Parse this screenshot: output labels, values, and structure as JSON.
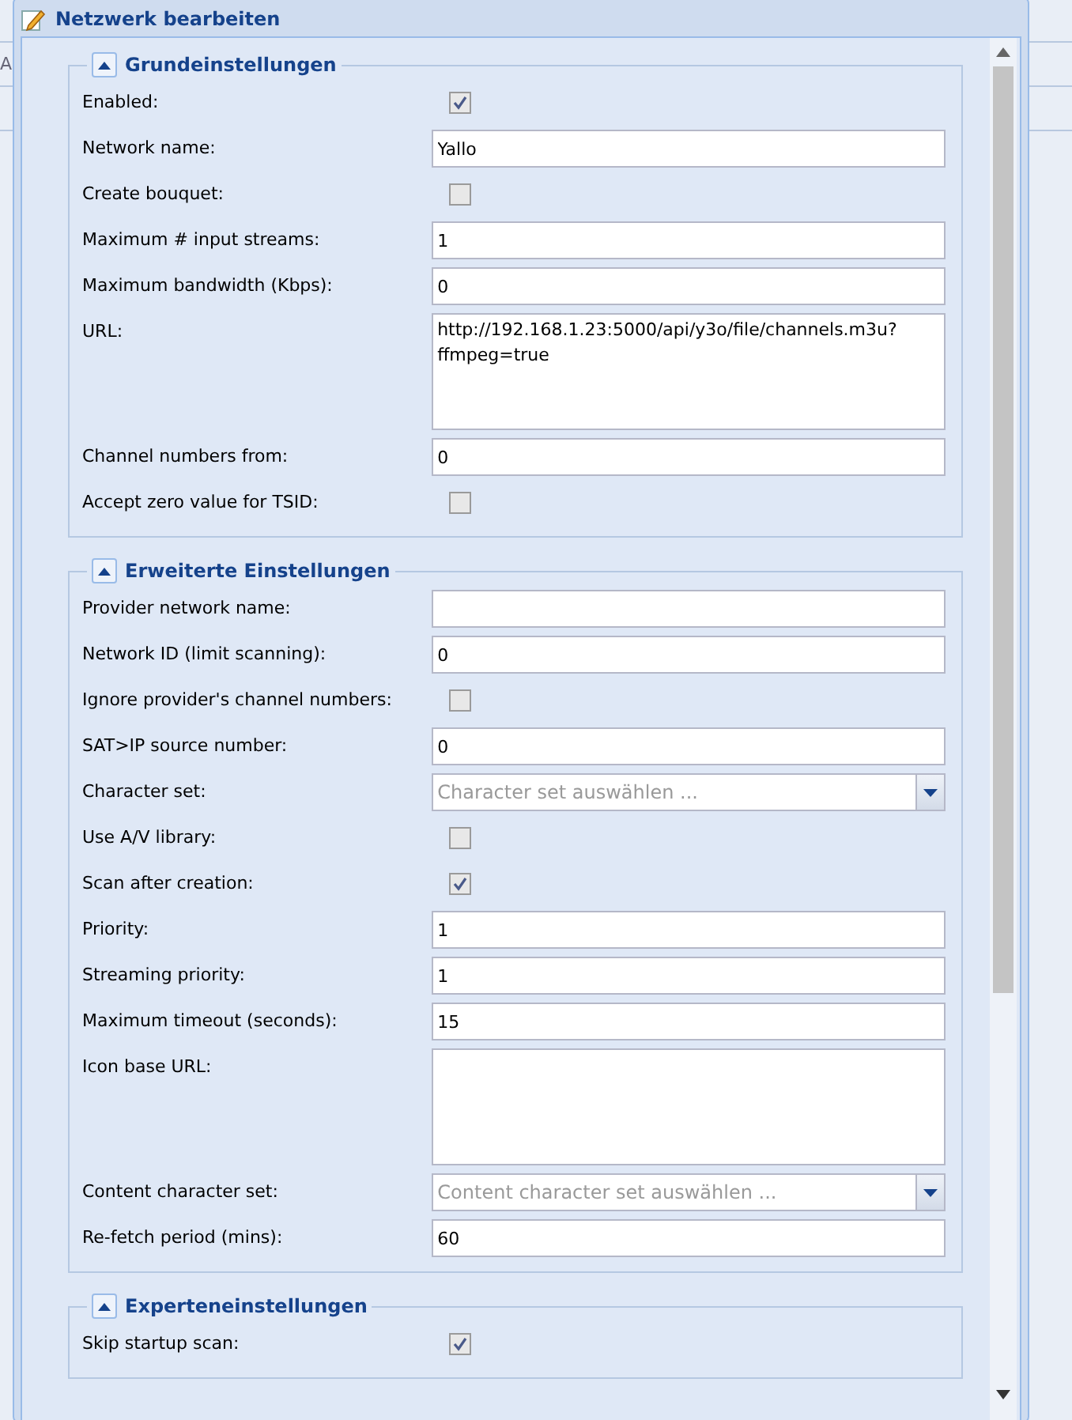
{
  "background": {
    "fragment": "A"
  },
  "window": {
    "title": "Netzwerk bearbeiten"
  },
  "fieldsets": [
    {
      "legend": "Grundeinstellungen",
      "expanded": true,
      "fields": [
        {
          "kind": "checkbox",
          "label": "Enabled:",
          "checked": true
        },
        {
          "kind": "text",
          "label": "Network name:",
          "value": "Yallo"
        },
        {
          "kind": "checkbox",
          "label": "Create bouquet:",
          "checked": false
        },
        {
          "kind": "text",
          "label": "Maximum # input streams:",
          "value": "1"
        },
        {
          "kind": "text",
          "label": "Maximum bandwidth (Kbps):",
          "value": "0"
        },
        {
          "kind": "textarea",
          "label": "URL:",
          "value": "http://192.168.1.23:5000/api/y3o/file/channels.m3u?ffmpeg=true"
        },
        {
          "kind": "text",
          "label": "Channel numbers from:",
          "value": "0"
        },
        {
          "kind": "checkbox",
          "label": "Accept zero value for TSID:",
          "checked": false
        }
      ]
    },
    {
      "legend": "Erweiterte Einstellungen",
      "expanded": true,
      "fields": [
        {
          "kind": "text",
          "label": "Provider network name:"
        },
        {
          "kind": "text",
          "label": "Network ID (limit scanning):",
          "value": "0"
        },
        {
          "kind": "checkbox",
          "label": "Ignore provider's channel numbers:",
          "checked": false
        },
        {
          "kind": "text",
          "label": "SAT>IP source number:",
          "value": "0"
        },
        {
          "kind": "combo",
          "label": "Character set:",
          "placeholder": "Character set auswählen ..."
        },
        {
          "kind": "checkbox",
          "label": "Use A/V library:",
          "checked": false
        },
        {
          "kind": "checkbox",
          "label": "Scan after creation:",
          "checked": true
        },
        {
          "kind": "text",
          "label": "Priority:",
          "value": "1"
        },
        {
          "kind": "text",
          "label": "Streaming priority:",
          "value": "1"
        },
        {
          "kind": "text",
          "label": "Maximum timeout (seconds):",
          "value": "15"
        },
        {
          "kind": "textarea",
          "label": "Icon base URL:"
        },
        {
          "kind": "combo",
          "label": "Content character set:",
          "placeholder": "Content character set auswählen ..."
        },
        {
          "kind": "text",
          "label": "Re-fetch period (mins):",
          "value": "60"
        }
      ]
    },
    {
      "legend": "Experteneinstellungen",
      "expanded": true,
      "fields": [
        {
          "kind": "checkbox",
          "label": "Skip startup scan:",
          "checked": true
        }
      ]
    }
  ]
}
